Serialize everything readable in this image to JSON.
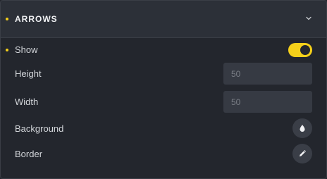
{
  "section": {
    "title": "ARROWS",
    "indicator_color": "#f5d01a",
    "collapse_icon": "chevron-down-icon"
  },
  "fields": {
    "show": {
      "label": "Show",
      "enabled": true
    },
    "height": {
      "label": "Height",
      "value": "",
      "placeholder": "50"
    },
    "width": {
      "label": "Width",
      "value": "",
      "placeholder": "50"
    },
    "background": {
      "label": "Background",
      "icon": "droplet-icon"
    },
    "border": {
      "label": "Border",
      "icon": "pencil-icon"
    }
  }
}
